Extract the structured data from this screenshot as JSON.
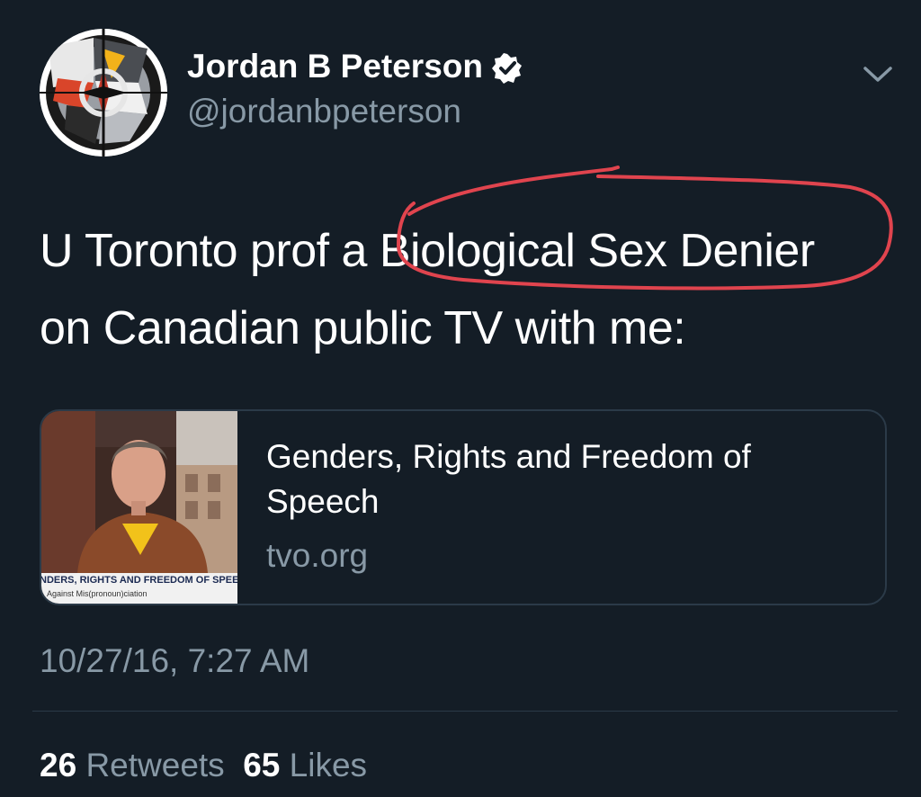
{
  "user": {
    "display_name": "Jordan B Peterson",
    "handle": "@jordanbpeterson",
    "verified": true,
    "avatar_icon": "abstract-geometric-avatar-icon"
  },
  "tweet": {
    "text_line1_prefix": "U Toronto prof a",
    "text_highlight": "Biological Sex Denier",
    "text_line2": "on Canadian public TV with me:",
    "annotation_color": "#e0444e"
  },
  "card": {
    "title": "Genders, Rights and Freedom of Speech",
    "domain": "tvo.org",
    "thumb_lower_third_line1": "NDERS, RIGHTS AND FREEDOM OF SPEE",
    "thumb_lower_third_line2": "Against Mis(pronoun)ciation"
  },
  "timestamp": "10/27/16, 7:27 AM",
  "stats": {
    "retweets_count": "26",
    "retweets_label": "Retweets",
    "likes_count": "65",
    "likes_label": "Likes"
  },
  "colors": {
    "background": "#141d26",
    "secondary_text": "#8899a6",
    "border": "#2b3a48"
  }
}
